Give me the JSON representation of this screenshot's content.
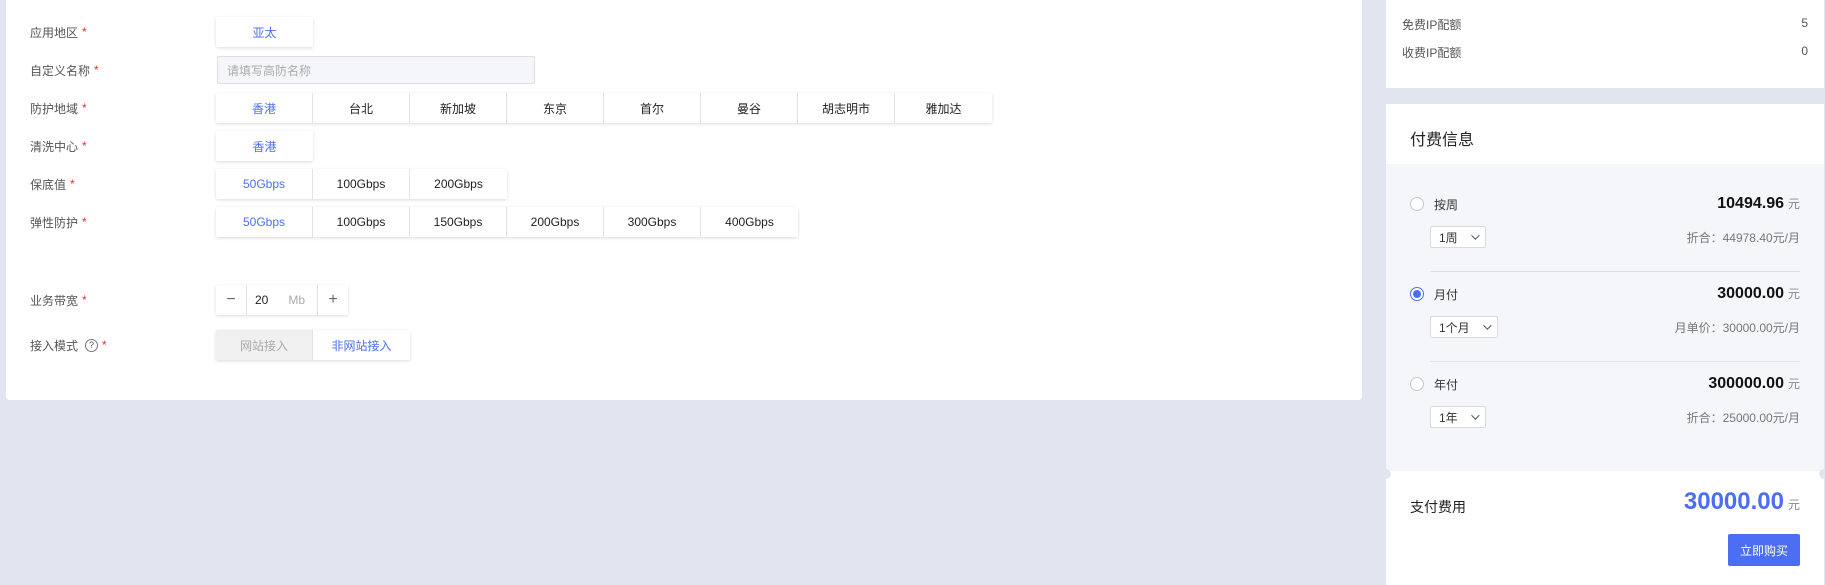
{
  "form": {
    "region": {
      "label": "应用地区",
      "options": [
        "亚太"
      ],
      "selected": 0
    },
    "custom_name": {
      "label": "自定义名称",
      "placeholder": "请填写高防名称"
    },
    "protect_area": {
      "label": "防护地域",
      "options": [
        "香港",
        "台北",
        "新加坡",
        "东京",
        "首尔",
        "曼谷",
        "胡志明市",
        "雅加达"
      ],
      "selected": 0
    },
    "clean_center": {
      "label": "清洗中心",
      "options": [
        "香港"
      ],
      "selected": 0
    },
    "base_value": {
      "label": "保底值",
      "options": [
        "50Gbps",
        "100Gbps",
        "200Gbps"
      ],
      "selected": 0
    },
    "elastic": {
      "label": "弹性防护",
      "options": [
        "50Gbps",
        "100Gbps",
        "150Gbps",
        "200Gbps",
        "300Gbps",
        "400Gbps"
      ],
      "selected": 0
    },
    "bandwidth": {
      "label": "业务带宽",
      "value": "20",
      "unit": "Mb",
      "minus": "−",
      "plus": "+"
    },
    "access_mode": {
      "label": "接入模式",
      "options": [
        "网站接入",
        "非网站接入"
      ],
      "selected": 1,
      "help": "?"
    },
    "required_mark": "*"
  },
  "quota": {
    "free_label": "免费IP配额",
    "free_value": "5",
    "paid_label": "收费IP配额",
    "paid_value": "0"
  },
  "payment": {
    "title": "付费信息",
    "currency": "元",
    "plans": [
      {
        "name": "按周",
        "price": "10494.96",
        "period": "1周",
        "note": "折合：44978.40元/月",
        "checked": false
      },
      {
        "name": "月付",
        "price": "30000.00",
        "period": "1个月",
        "note": "月单价：30000.00元/月",
        "checked": true
      },
      {
        "name": "年付",
        "price": "300000.00",
        "period": "1年",
        "note": "折合：25000.00元/月",
        "checked": false
      }
    ],
    "total_label": "支付费用",
    "total_price": "30000.00",
    "buy_label": "立即购买"
  },
  "colors": {
    "accent": "#4c6ef5",
    "required": "#e5322d",
    "background": "#e1e5ef"
  }
}
